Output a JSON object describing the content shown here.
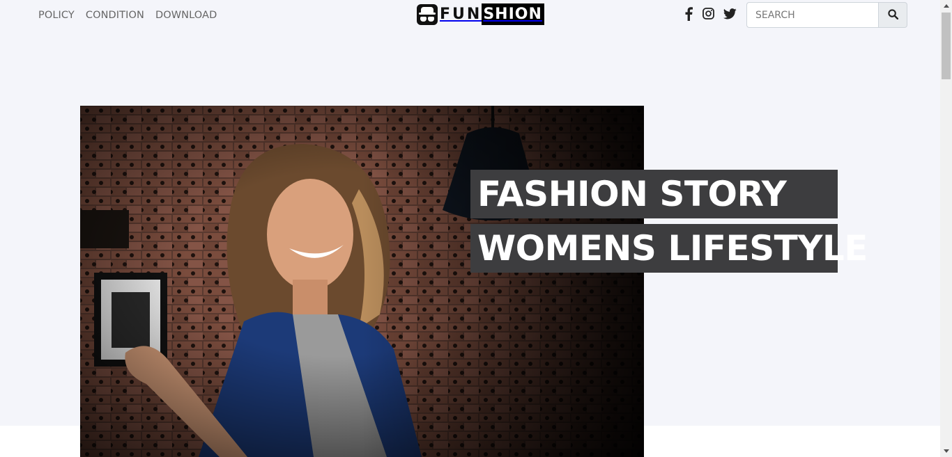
{
  "nav": {
    "links": [
      "POLICY",
      "CONDITION",
      "DOWNLOAD"
    ]
  },
  "logo": {
    "part1": "FUN",
    "part2": "SHION"
  },
  "social": {
    "icons": [
      "facebook-icon",
      "instagram-icon",
      "twitter-icon"
    ]
  },
  "search": {
    "placeholder": "SEARCH",
    "button_icon": "search-icon"
  },
  "hero": {
    "headline_line1": "FASHION STORY",
    "headline_line2": "WOMENS LIFESTYLE"
  },
  "colors": {
    "page_background": "#f4f5fa",
    "headline_background": "#3d3d3f",
    "logo_black": "#000000"
  }
}
